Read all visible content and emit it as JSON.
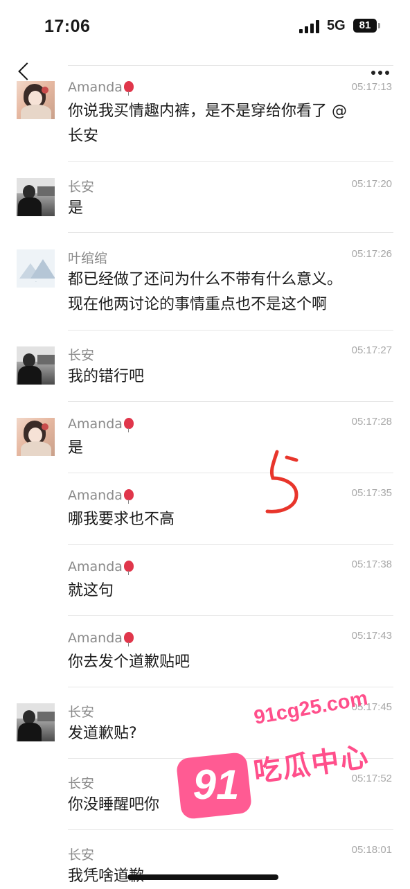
{
  "status_bar": {
    "time": "17:06",
    "network": "5G",
    "battery": "81"
  },
  "messages": [
    {
      "sender": "Amanda",
      "time": "05:17:13",
      "lines": [
        "你说我买情趣内裤，是不是穿给你看了 @",
        "长安"
      ]
    },
    {
      "sender": "长安",
      "time": "05:17:20",
      "lines": [
        "是"
      ]
    },
    {
      "sender": "叶绾绾",
      "time": "05:17:26",
      "lines": [
        "都已经做了还问为什么不带有什么意义。",
        "现在他两讨论的事情重点也不是这个啊"
      ]
    },
    {
      "sender": "长安",
      "time": "05:17:27",
      "lines": [
        "我的错行吧"
      ]
    },
    {
      "sender": "Amanda",
      "time": "05:17:28",
      "lines": [
        "是"
      ]
    },
    {
      "sender": "Amanda",
      "time": "05:17:35",
      "lines": [
        "哪我要求也不高"
      ]
    },
    {
      "sender": "Amanda",
      "time": "05:17:38",
      "lines": [
        "就这句"
      ]
    },
    {
      "sender": "Amanda",
      "time": "05:17:43",
      "lines": [
        "你去发个道歉贴吧"
      ]
    },
    {
      "sender": "长安",
      "time": "05:17:45",
      "lines": [
        "发道歉贴?"
      ]
    },
    {
      "sender": "长安",
      "time": "05:17:52",
      "lines": [
        "你没睡醒吧你"
      ]
    },
    {
      "sender": "长安",
      "time": "05:18:01",
      "lines": [
        "我凭啥道歉"
      ]
    }
  ],
  "watermark": {
    "url": "91cg25.com",
    "number": "91",
    "name": "吃瓜中心"
  },
  "colors": {
    "accent": "#ff4f8b",
    "balloon": "#e0364b",
    "squiggle": "#e8352b"
  }
}
